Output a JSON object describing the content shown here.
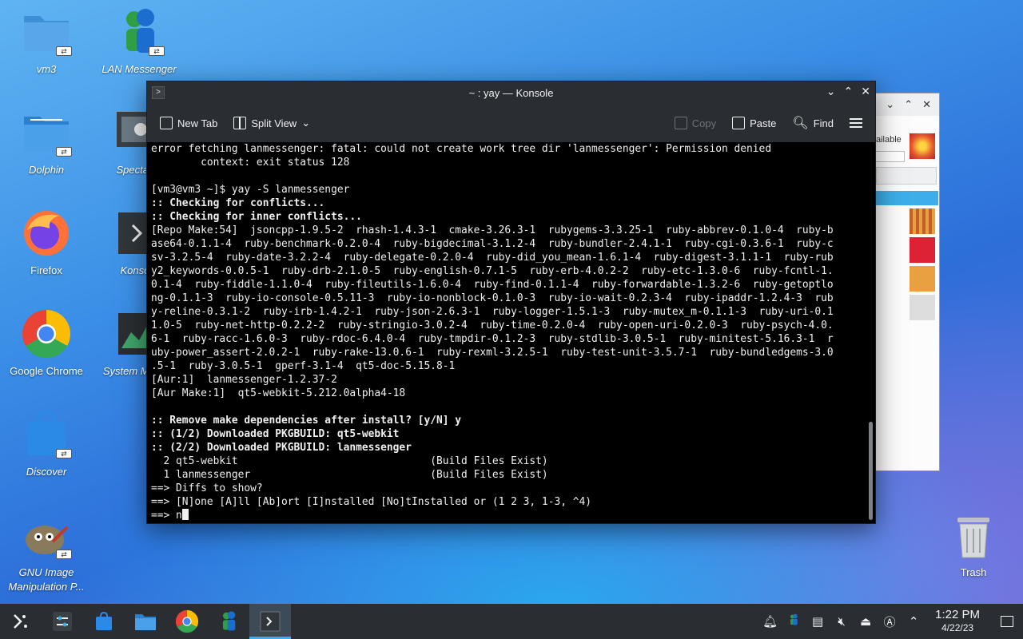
{
  "desktop": {
    "icons": [
      {
        "label": "vm3"
      },
      {
        "label": "LAN Messenger"
      },
      {
        "label": "Dolphin"
      },
      {
        "label": "Spectacle"
      },
      {
        "label": "Firefox"
      },
      {
        "label": "Konsole"
      },
      {
        "label": "Google Chrome"
      },
      {
        "label": "System Monitor"
      },
      {
        "label": "Discover"
      },
      {
        "label": "GNU Image Manipulation P..."
      }
    ],
    "trash_label": "Trash"
  },
  "background_window": {
    "partial_text": "ailable"
  },
  "konsole": {
    "title": "~ : yay — Konsole",
    "toolbar": {
      "new_tab": "New Tab",
      "split_view": "Split View",
      "copy": "Copy",
      "paste": "Paste",
      "find": "Find"
    },
    "lines": [
      {
        "text": "error fetching lanmessenger: fatal: could not create work tree dir 'lanmessenger': Permission denied",
        "bold": false
      },
      {
        "text": "        context: exit status 128",
        "bold": false
      },
      {
        "text": "",
        "bold": false
      },
      {
        "text": "[vm3@vm3 ~]$ yay -S lanmessenger",
        "bold": false
      },
      {
        "text": ":: Checking for conflicts...",
        "bold": true
      },
      {
        "text": ":: Checking for inner conflicts...",
        "bold": true
      },
      {
        "text": "[Repo Make:54]  jsoncpp-1.9.5-2  rhash-1.4.3-1  cmake-3.26.3-1  rubygems-3.3.25-1  ruby-abbrev-0.1.0-4  ruby-b",
        "bold": false
      },
      {
        "text": "ase64-0.1.1-4  ruby-benchmark-0.2.0-4  ruby-bigdecimal-3.1.2-4  ruby-bundler-2.4.1-1  ruby-cgi-0.3.6-1  ruby-c",
        "bold": false
      },
      {
        "text": "sv-3.2.5-4  ruby-date-3.2.2-4  ruby-delegate-0.2.0-4  ruby-did_you_mean-1.6.1-4  ruby-digest-3.1.1-1  ruby-rub",
        "bold": false
      },
      {
        "text": "y2_keywords-0.0.5-1  ruby-drb-2.1.0-5  ruby-english-0.7.1-5  ruby-erb-4.0.2-2  ruby-etc-1.3.0-6  ruby-fcntl-1.",
        "bold": false
      },
      {
        "text": "0.1-4  ruby-fiddle-1.1.0-4  ruby-fileutils-1.6.0-4  ruby-find-0.1.1-4  ruby-forwardable-1.3.2-6  ruby-getoptlo",
        "bold": false
      },
      {
        "text": "ng-0.1.1-3  ruby-io-console-0.5.11-3  ruby-io-nonblock-0.1.0-3  ruby-io-wait-0.2.3-4  ruby-ipaddr-1.2.4-3  rub",
        "bold": false
      },
      {
        "text": "y-reline-0.3.1-2  ruby-irb-1.4.2-1  ruby-json-2.6.3-1  ruby-logger-1.5.1-3  ruby-mutex_m-0.1.1-3  ruby-uri-0.1",
        "bold": false
      },
      {
        "text": "1.0-5  ruby-net-http-0.2.2-2  ruby-stringio-3.0.2-4  ruby-time-0.2.0-4  ruby-open-uri-0.2.0-3  ruby-psych-4.0.",
        "bold": false
      },
      {
        "text": "6-1  ruby-racc-1.6.0-3  ruby-rdoc-6.4.0-4  ruby-tmpdir-0.1.2-3  ruby-stdlib-3.0.5-1  ruby-minitest-5.16.3-1  r",
        "bold": false
      },
      {
        "text": "uby-power_assert-2.0.2-1  ruby-rake-13.0.6-1  ruby-rexml-3.2.5-1  ruby-test-unit-3.5.7-1  ruby-bundledgems-3.0",
        "bold": false
      },
      {
        "text": ".5-1  ruby-3.0.5-1  gperf-3.1-4  qt5-doc-5.15.8-1",
        "bold": false
      },
      {
        "text": "[Aur:1]  lanmessenger-1.2.37-2",
        "bold": false
      },
      {
        "text": "[Aur Make:1]  qt5-webkit-5.212.0alpha4-18",
        "bold": false
      },
      {
        "text": "",
        "bold": false
      },
      {
        "text": ":: Remove make dependencies after install? [y/N] y",
        "bold": true
      },
      {
        "text": ":: (1/2) Downloaded PKGBUILD: qt5-webkit",
        "bold": true
      },
      {
        "text": ":: (2/2) Downloaded PKGBUILD: lanmessenger",
        "bold": true
      },
      {
        "text": "  2 qt5-webkit                               (Build Files Exist)",
        "bold": false
      },
      {
        "text": "  1 lanmessenger                             (Build Files Exist)",
        "bold": false
      },
      {
        "text": "==> Diffs to show?",
        "bold": false
      },
      {
        "text": "==> [N]one [A]ll [Ab]ort [I]nstalled [No]tInstalled or (1 2 3, 1-3, ^4)",
        "bold": false
      }
    ],
    "prompt_line": "==> n"
  },
  "taskbar": {
    "clock_time": "1:22 PM",
    "clock_date": "4/22/23"
  },
  "colors": {
    "terminal_bg": "#000000",
    "panel_bg": "#2a2e32",
    "accent": "#3daee9"
  }
}
